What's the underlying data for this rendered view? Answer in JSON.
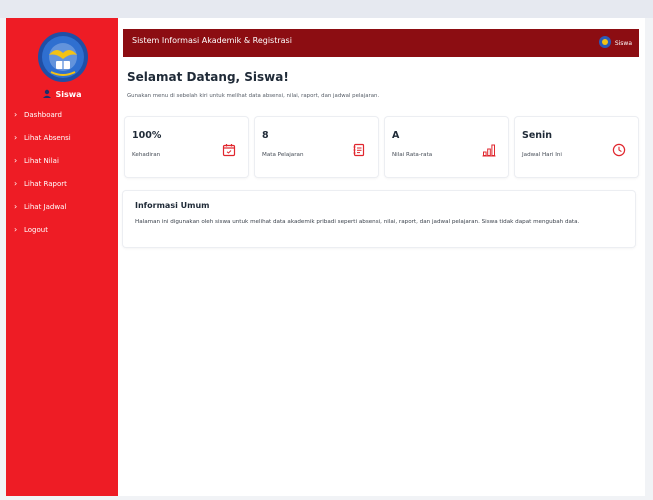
{
  "sidebar": {
    "brand": "Siswa",
    "items": [
      {
        "label": "Dashboard"
      },
      {
        "label": "Lihat Absensi"
      },
      {
        "label": "Lihat Nilai"
      },
      {
        "label": "Lihat Raport"
      },
      {
        "label": "Lihat Jadwal"
      },
      {
        "label": "Logout"
      }
    ]
  },
  "header": {
    "title": "Sistem Informasi Akademik & Registrasi",
    "user": "Siswa"
  },
  "welcome": {
    "title": "Selamat Datang, Siswa!",
    "subtitle": "Gunakan menu di sebelah kiri untuk melihat data absensi, nilai, raport, dan jadwal pelajaran."
  },
  "cards": [
    {
      "value": "100%",
      "label": "Kehadiran",
      "icon": "calendar-check-icon"
    },
    {
      "value": "8",
      "label": "Mata Pelajaran",
      "icon": "book-list-icon"
    },
    {
      "value": "A",
      "label": "Nilai Rata-rata",
      "icon": "bar-chart-icon"
    },
    {
      "value": "Senin",
      "label": "Jadwal Hari Ini",
      "icon": "clock-icon"
    }
  ],
  "info": {
    "title": "Informasi Umum",
    "body": "Halaman ini digunakan oleh siswa untuk melihat data akademik pribadi seperti absensi, nilai, raport, dan jadwal pelajaran. Siswa tidak dapat mengubah data."
  },
  "colors": {
    "sidebar": "#ee1c25",
    "header": "#8c0d12",
    "icon_accent": "#e0262d"
  }
}
